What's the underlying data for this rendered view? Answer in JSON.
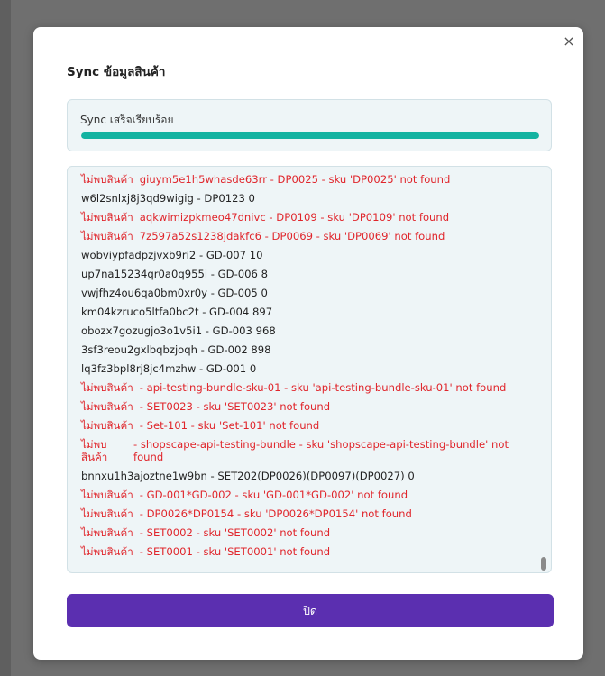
{
  "modal": {
    "title": "Sync ข้อมูลสินค้า",
    "close_icon": "×"
  },
  "status": {
    "text": "Sync เสร็จเรียบร้อย",
    "progress": 1.0,
    "color": "#13b3a1"
  },
  "log": [
    {
      "type": "err",
      "prefix": "ไม่พบสินค้า",
      "message": "giuym5e1h5whasde63rr - DP0025 - sku 'DP0025' not found"
    },
    {
      "type": "ok",
      "prefix": "",
      "message": "w6l2snlxj8j3qd9wigig - DP0123 0"
    },
    {
      "type": "err",
      "prefix": "ไม่พบสินค้า",
      "message": "aqkwimizpkmeo47dnivc - DP0109 - sku 'DP0109' not found"
    },
    {
      "type": "err",
      "prefix": "ไม่พบสินค้า",
      "message": "7z597a52s1238jdakfc6 - DP0069 - sku 'DP0069' not found"
    },
    {
      "type": "ok",
      "prefix": "",
      "message": "wobviypfadpzjvxb9ri2 - GD-007 10"
    },
    {
      "type": "ok",
      "prefix": "",
      "message": "up7na15234qr0a0q955i - GD-006 8"
    },
    {
      "type": "ok",
      "prefix": "",
      "message": "vwjfhz4ou6qa0bm0xr0y - GD-005 0"
    },
    {
      "type": "ok",
      "prefix": "",
      "message": "km04kzruco5ltfa0bc2t - GD-004 897"
    },
    {
      "type": "ok",
      "prefix": "",
      "message": "obozx7gozugjo3o1v5i1 - GD-003 968"
    },
    {
      "type": "ok",
      "prefix": "",
      "message": "3sf3reou2gxlbqbzjoqh - GD-002 898"
    },
    {
      "type": "ok",
      "prefix": "",
      "message": "lq3fz3bpl8rj8jc4mzhw - GD-001 0"
    },
    {
      "type": "err",
      "prefix": "ไม่พบสินค้า",
      "message": "- api-testing-bundle-sku-01 - sku 'api-testing-bundle-sku-01' not found"
    },
    {
      "type": "err",
      "prefix": "ไม่พบสินค้า",
      "message": "- SET0023 - sku 'SET0023' not found"
    },
    {
      "type": "err",
      "prefix": "ไม่พบสินค้า",
      "message": "- Set-101 - sku 'Set-101' not found"
    },
    {
      "type": "err",
      "wrap": true,
      "prefix": "ไม่พบ สินค้า",
      "message": "- shopscape-api-testing-bundle - sku 'shopscape-api-testing-bundle' not found"
    },
    {
      "type": "ok",
      "prefix": "",
      "message": "bnnxu1h3ajoztne1w9bn - SET202(DP0026)(DP0097)(DP0027) 0"
    },
    {
      "type": "err",
      "prefix": "ไม่พบสินค้า",
      "message": "- GD-001*GD-002 - sku 'GD-001*GD-002' not found"
    },
    {
      "type": "err",
      "prefix": "ไม่พบสินค้า",
      "message": "- DP0026*DP0154 - sku 'DP0026*DP0154' not found"
    },
    {
      "type": "err",
      "prefix": "ไม่พบสินค้า",
      "message": "- SET0002 - sku 'SET0002' not found"
    },
    {
      "type": "err",
      "prefix": "ไม่พบสินค้า",
      "message": "- SET0001 - sku 'SET0001' not found"
    }
  ],
  "footer": {
    "close_label": "ปิด",
    "button_color": "#5b2fb0"
  }
}
